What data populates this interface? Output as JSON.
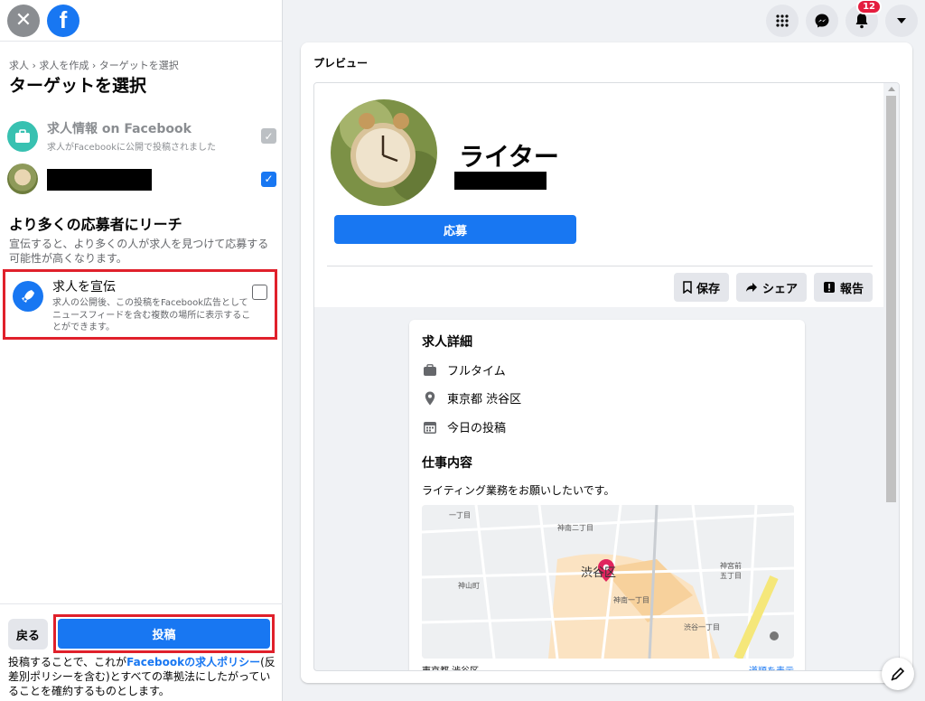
{
  "sidebar": {
    "breadcrumb": "求人 › 求人を作成 › ターゲットを選択",
    "title": "ターゲットを選択",
    "options": [
      {
        "title": "求人情報 on Facebook",
        "subtitle": "求人がFacebookに公開で投稿されました",
        "checked": true,
        "disabled": true
      },
      {
        "title": "",
        "subtitle": "",
        "checked": true,
        "disabled": false
      }
    ],
    "reach_title": "より多くの応募者にリーチ",
    "reach_desc": "宣伝すると、より多くの人が求人を見つけて応募する可能性が高くなります。",
    "promote": {
      "title": "求人を宣伝",
      "desc": "求人の公開後、この投稿をFacebook広告としてニュースフィードを含む複数の場所に表示することができます。",
      "checked": false
    },
    "back_label": "戻る",
    "post_label": "投稿",
    "legal_prefix": "投稿することで、これが",
    "legal_link": "Facebookの求人ポリシー",
    "legal_suffix": "(反差別ポリシーを含む)とすべての準拠法にしたがっていることを確約するものとします。"
  },
  "topbar": {
    "notifications_count": "12"
  },
  "preview": {
    "label": "プレビュー",
    "job_title": "ライター",
    "apply_label": "応募",
    "save_label": "保存",
    "share_label": "シェア",
    "report_label": "報告",
    "details_title": "求人詳細",
    "employment_type": "フルタイム",
    "location": "東京都 渋谷区",
    "posted": "今日の投稿",
    "job_content_title": "仕事内容",
    "job_content": "ライティング業務をお願いしたいです。",
    "map_labels": {
      "jinnan2": "神南二丁目",
      "shibuya": "渋谷区",
      "kamiyama": "神山町",
      "jinnan1": "神南一丁目",
      "jingumae5": "神宮前五丁目",
      "shibuya1": "渋谷一丁目",
      "choume": "一丁目"
    },
    "bottom_location": "東京都 渋谷区",
    "directions": "道順を表示"
  },
  "colors": {
    "accent": "#1877f2",
    "highlight": "#e0202b"
  }
}
